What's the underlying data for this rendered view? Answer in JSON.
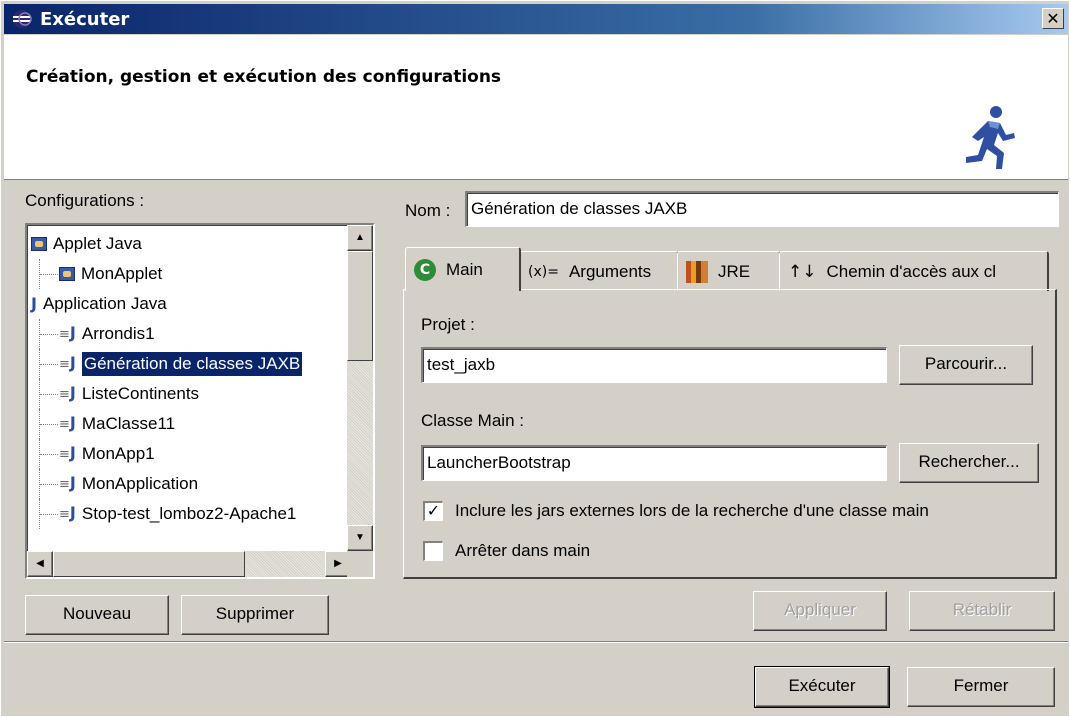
{
  "window": {
    "title": "Exécuter",
    "close_label": "✕"
  },
  "banner": {
    "heading": "Création, gestion et exécution des configurations",
    "icon": "running-man-icon"
  },
  "configurations": {
    "label": "Configurations :",
    "tree": [
      {
        "label": "Applet Java",
        "level": 0,
        "icon": "applet-icon"
      },
      {
        "label": "MonApplet",
        "level": 1,
        "icon": "applet-icon"
      },
      {
        "label": "Application Java",
        "level": 0,
        "icon": "java-icon"
      },
      {
        "label": "Arrondis1",
        "level": 1,
        "icon": "java-icon"
      },
      {
        "label": "Génération de classes JAXB",
        "level": 1,
        "icon": "java-icon",
        "selected": true
      },
      {
        "label": "ListeContinents",
        "level": 1,
        "icon": "java-icon"
      },
      {
        "label": "MaClasse11",
        "level": 1,
        "icon": "java-icon"
      },
      {
        "label": "MonApp1",
        "level": 1,
        "icon": "java-icon"
      },
      {
        "label": "MonApplication",
        "level": 1,
        "icon": "java-icon"
      },
      {
        "label": "Stop-test_lomboz2-Apache1",
        "level": 1,
        "icon": "java-icon"
      }
    ],
    "new_button": "Nouveau",
    "delete_button": "Supprimer"
  },
  "form": {
    "name_label": "Nom :",
    "name_value": "Génération de classes JAXB",
    "tabs": [
      {
        "label": "Main",
        "icon": "main-class-icon",
        "active": true
      },
      {
        "label": "Arguments",
        "icon": "arguments-icon"
      },
      {
        "label": "JRE",
        "icon": "jre-library-icon"
      },
      {
        "label": "Chemin d'accès aux cl",
        "icon": "classpath-icon"
      }
    ],
    "project_label": "Projet :",
    "project_value": "test_jaxb",
    "browse_button": "Parcourir...",
    "main_class_label": "Classe Main :",
    "main_class_value": "LauncherBootstrap",
    "search_button": "Rechercher...",
    "include_jars_label": "Inclure les jars externes lors de la recherche d'une classe main",
    "include_jars_checked": true,
    "stop_in_main_label": "Arrêter dans main",
    "stop_in_main_checked": false,
    "apply_button": "Appliquer",
    "revert_button": "Rétablir"
  },
  "footer": {
    "run_button": "Exécuter",
    "close_button": "Fermer"
  }
}
